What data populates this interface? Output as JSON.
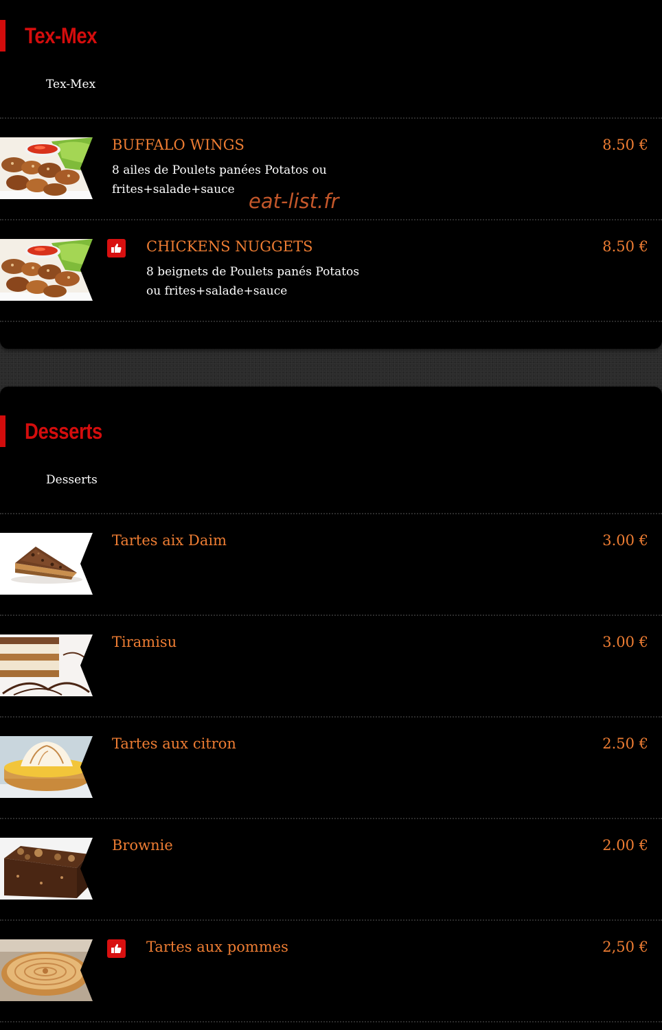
{
  "sections": [
    {
      "title": "Tex-Mex",
      "subtitle": "Tex-Mex",
      "items": [
        {
          "name": "BUFFALO WINGS",
          "description": "8 ailes de Poulets panées Potatos ou frites+salade+sauce",
          "price": "8.50 €",
          "image": "chicken-wings-image",
          "recommended": false
        },
        {
          "name": "CHICKENS NUGGETS",
          "description": "8 beignets de Poulets panés Potatos ou frites+salade+sauce",
          "price": "8.50 €",
          "image": "chicken-wings-image",
          "recommended": true
        }
      ]
    },
    {
      "title": "Desserts",
      "subtitle": "Desserts",
      "items": [
        {
          "name": "Tartes aix Daim",
          "price": "3.00 €",
          "image": "daim-tart-image",
          "recommended": false
        },
        {
          "name": "Tiramisu",
          "price": "3.00 €",
          "image": "tiramisu-image",
          "recommended": false
        },
        {
          "name": "Tartes aux citron",
          "price": "2.50 €",
          "image": "lemon-tart-image",
          "recommended": false
        },
        {
          "name": "Brownie",
          "price": "2.00 €",
          "image": "brownie-image",
          "recommended": false
        },
        {
          "name": "Tartes aux pommes",
          "price": "2,50 €",
          "image": "apple-tart-image",
          "recommended": true
        }
      ]
    }
  ],
  "watermark": "eat-list.fr",
  "icons": {
    "recommended": "thumbs-up-icon"
  },
  "colors": {
    "section_title": "#d40d0d",
    "item_text": "#ee7d33",
    "badge": "#d81010",
    "background": "#000000"
  }
}
